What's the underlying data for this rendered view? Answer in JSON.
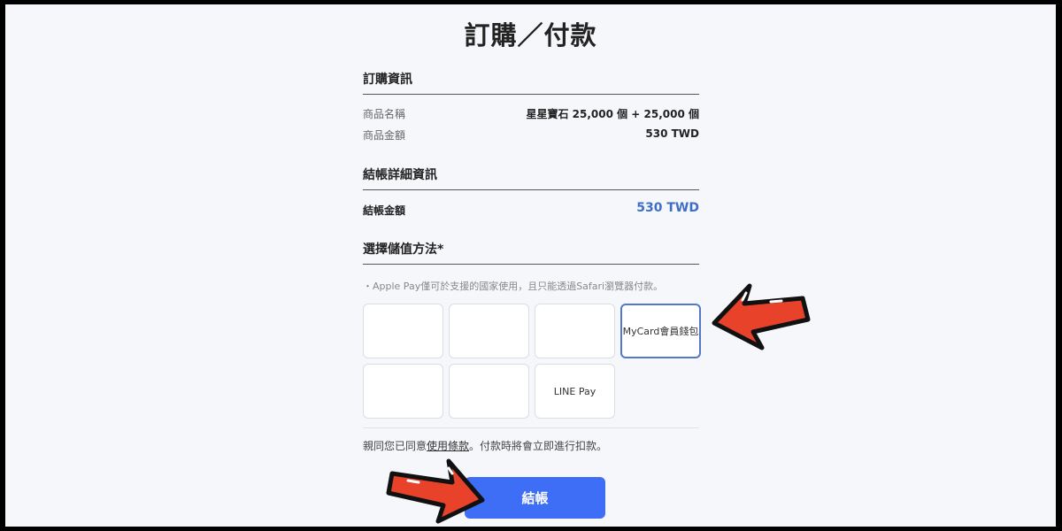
{
  "page_title": "訂購／付款",
  "order_info": {
    "title": "訂購資訊",
    "product_name_label": "商品名稱",
    "product_name_value": "星星寶石 25,000 個 + 25,000 個",
    "product_price_label": "商品金額",
    "product_price_value": "530 TWD"
  },
  "checkout_details": {
    "title": "結帳詳細資訊",
    "amount_label": "結帳金額",
    "amount_value": "530 TWD",
    "accent_color": "#3f6ec9"
  },
  "payment": {
    "title": "選擇儲值方法*",
    "note": "・Apple Pay僅可於支援的國家使用，且只能透過Safari瀏覽器付款。",
    "options": [
      {
        "label": ""
      },
      {
        "label": ""
      },
      {
        "label": ""
      },
      {
        "label": "MyCard會員錢包",
        "selected": true
      },
      {
        "label": ""
      },
      {
        "label": ""
      },
      {
        "label": "LINE Pay"
      }
    ]
  },
  "terms": {
    "prefix": "親同您已同意",
    "link": "使用條款",
    "suffix": "。付款時將會立即進行扣款。"
  },
  "checkout_button": {
    "label": "結帳",
    "color": "#3d6ef5"
  },
  "annotation_arrows": {
    "color": "#e8432a"
  }
}
